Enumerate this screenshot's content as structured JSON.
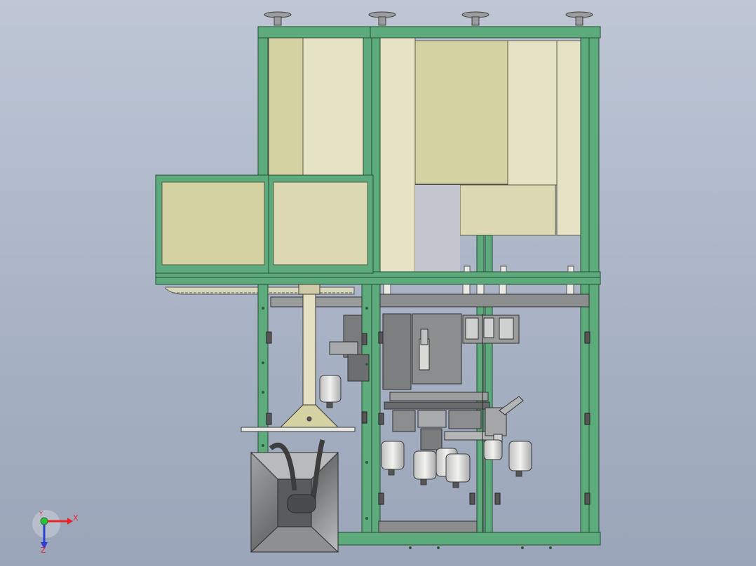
{
  "viewport": {
    "triad": {
      "x_label": "X",
      "y_label": "Y",
      "z_label": "Z"
    }
  },
  "colors": {
    "frame_green": "#5dab7d",
    "frame_green_dark": "#2f7a4c",
    "panel_beige": "#d4d1a2",
    "panel_beige_light": "#ddd9b3",
    "panel_cream": "#e6e2c6",
    "steel_grey": "#8c8d8e",
    "dark_grey": "#6a6b6c",
    "light_grey": "#cfd0d0"
  },
  "icons": {
    "triad": "coordinate-triad-icon"
  }
}
